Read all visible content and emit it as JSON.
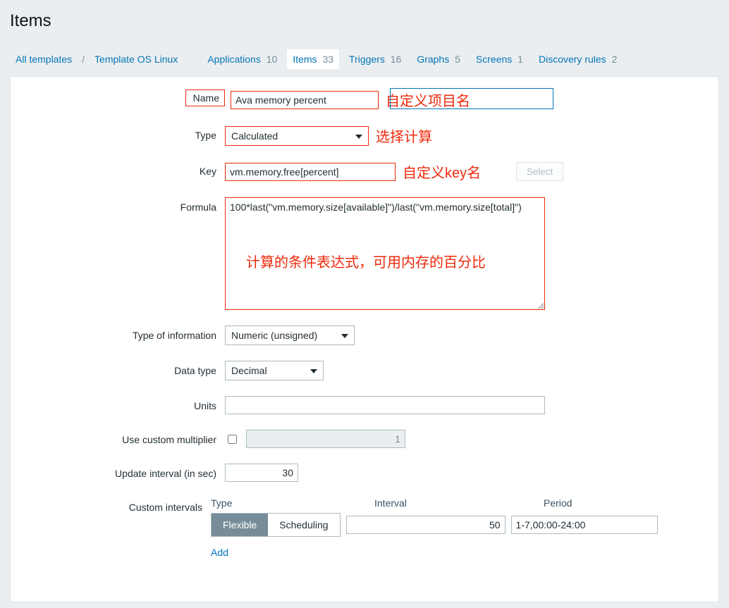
{
  "page": {
    "title": "Items"
  },
  "breadcrumb": {
    "all_templates": "All templates",
    "template_name": "Template OS Linux"
  },
  "tabs": {
    "applications": {
      "label": "Applications",
      "count": "10"
    },
    "items": {
      "label": "Items",
      "count": "33"
    },
    "triggers": {
      "label": "Triggers",
      "count": "16"
    },
    "graphs": {
      "label": "Graphs",
      "count": "5"
    },
    "screens": {
      "label": "Screens",
      "count": "1"
    },
    "discovery": {
      "label": "Discovery rules",
      "count": "2"
    }
  },
  "form": {
    "name_label": "Name",
    "name_value": "Ava memory percent",
    "type_label": "Type",
    "type_value": "Calculated",
    "key_label": "Key",
    "key_value": "vm.memory.free[percent]",
    "select_btn": "Select",
    "formula_label": "Formula",
    "formula_value": "100*last(\"vm.memory.size[available]\")/last(\"vm.memory.size[total]\")",
    "info_type_label": "Type of information",
    "info_type_value": "Numeric (unsigned)",
    "data_type_label": "Data type",
    "data_type_value": "Decimal",
    "units_label": "Units",
    "units_value": "",
    "multiplier_label": "Use custom multiplier",
    "multiplier_value": "1",
    "update_interval_label": "Update interval (in sec)",
    "update_interval_value": "30",
    "custom_intervals_label": "Custom intervals",
    "ci_head_type": "Type",
    "ci_head_interval": "Interval",
    "ci_head_period": "Period",
    "ci_seg_flexible": "Flexible",
    "ci_seg_scheduling": "Scheduling",
    "ci_interval_value": "50",
    "ci_period_value": "1-7,00:00-24:00",
    "add_link": "Add"
  },
  "annotations": {
    "name": "自定义项目名",
    "type": "选择计算",
    "key": "自定义key名",
    "formula": "计算的条件表达式，可用内存的百分比"
  }
}
